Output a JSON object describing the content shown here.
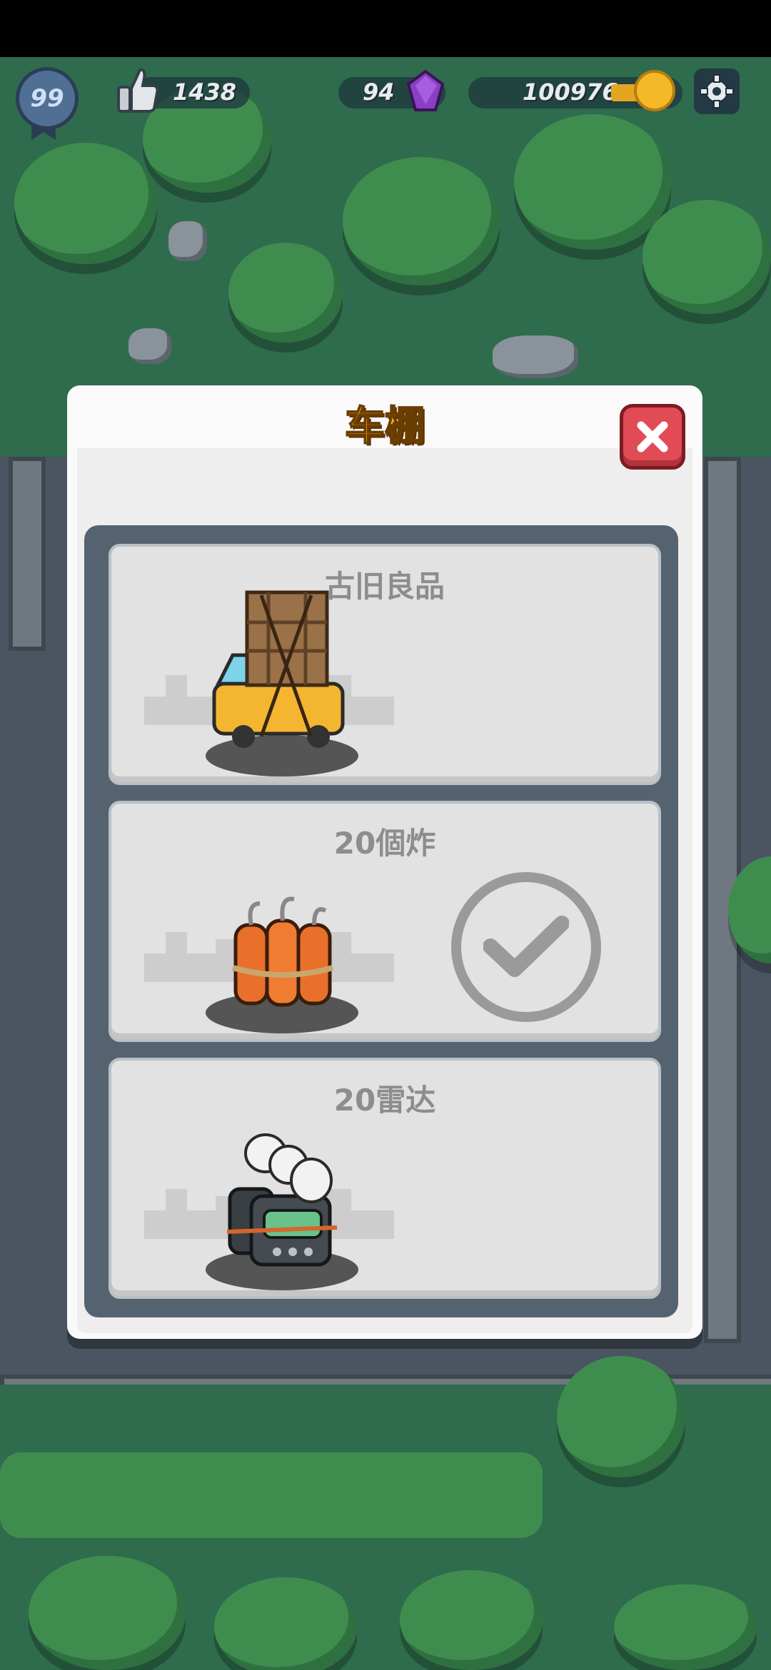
{
  "hud": {
    "level": "99",
    "likes": "1438",
    "gems": "94",
    "coins": "100976"
  },
  "modal": {
    "title": "车棚",
    "items": [
      {
        "label": "古旧良品",
        "icon": "vehicle-with-crates-icon",
        "selected": false
      },
      {
        "label": "20個炸",
        "icon": "dynamite-bundle-icon",
        "selected": true
      },
      {
        "label": "20雷达",
        "icon": "radar-dish-icon",
        "selected": false
      }
    ]
  },
  "colors": {
    "title": "#f6b21b",
    "close": "#e14b55",
    "panel": "#55626f",
    "card": "#e2e2e2"
  }
}
